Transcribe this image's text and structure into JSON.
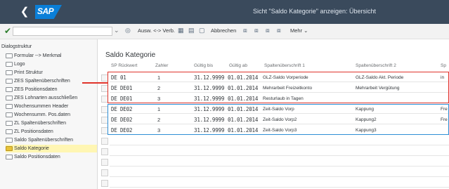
{
  "window": {
    "title": "Sicht \"Saldo Kategorie\" anzeigen: Übersicht",
    "logo": "SAP"
  },
  "toolbar": {
    "items": [
      {
        "label": "Ausw. <-> Verb."
      },
      {
        "label": "Abbrechen"
      },
      {
        "label": "Mehr"
      }
    ]
  },
  "tree": {
    "heading": "Dialogstruktur",
    "items": [
      {
        "label": "Formular --> Merkmal"
      },
      {
        "label": "Logo"
      },
      {
        "label": "Print Struktur"
      },
      {
        "label": "ZES Spaltenüberschriften"
      },
      {
        "label": "ZES Positionsdaten"
      },
      {
        "label": "ZES Lohnarten ausschließen"
      },
      {
        "label": "Wochensummen Header"
      },
      {
        "label": "Wochensumm. Pos.daten"
      },
      {
        "label": "ZL Spaltenüberschriften"
      },
      {
        "label": "ZL Positionsdaten"
      },
      {
        "label": "Saldo Spaltenüberschriften"
      },
      {
        "label": "Saldo Kategorie",
        "selected": true
      },
      {
        "label": "Saldo Positionsdaten"
      }
    ]
  },
  "main": {
    "section_title": "Saldo Kategorie",
    "columns": [
      "SP Rückwert",
      "Zahler",
      "Gültig bis",
      "Gültig ab",
      "Spaltenüberschrift 1",
      "Spaltenüberschrift 2",
      "Sp"
    ],
    "rows": [
      {
        "sp": "DE 01",
        "zahler": "1",
        "bis": "31.12.9999",
        "ab": "01.01.2014",
        "s1": "GLZ-Saldo Vorperiode",
        "s2": "GLZ-Saldo Akt. Periode",
        "s3": "in"
      },
      {
        "sp": "DE DE01",
        "zahler": "2",
        "bis": "31.12.9999",
        "ab": "01.01.2014",
        "s1": "Mehrarbeit Freizeitkonto",
        "s2": "Mehrarbeit Vergütung",
        "s3": ""
      },
      {
        "sp": "DE DE01",
        "zahler": "3",
        "bis": "31.12.9999",
        "ab": "01.01.2014",
        "s1": "Resturlaub in Tagen",
        "s2": "",
        "s3": ""
      },
      {
        "sp": "DE DE02",
        "zahler": "1",
        "bis": "31.12.9999",
        "ab": "01.01.2014",
        "s1": "Zeit-Saldo Vorp",
        "s2": "Kappung",
        "s3": "Fre"
      },
      {
        "sp": "DE DE02",
        "zahler": "2",
        "bis": "31.12.9999",
        "ab": "01.01.2014",
        "s1": "Zeit-Saldo Vorp2",
        "s2": "Kappung2",
        "s3": "Fre"
      },
      {
        "sp": "DE DE02",
        "zahler": "3",
        "bis": "31.12.9999",
        "ab": "01.01.2014",
        "s1": "Zeit-Saldo Vorp3",
        "s2": "Kappung3",
        "s3": ""
      }
    ]
  },
  "colors": {
    "titlebar": "#3a4a5c",
    "sap_blue": "#0a7fd8",
    "highlight_red": "#e0342b",
    "highlight_blue": "#2f8fd6",
    "selected_item": "#fff6b3"
  },
  "icons": [
    "back-icon",
    "check-icon",
    "dropdown-icon",
    "glasses-icon",
    "grid-icon",
    "copy-icon",
    "delete-icon",
    "folder-icon",
    "chevron-down-icon"
  ]
}
